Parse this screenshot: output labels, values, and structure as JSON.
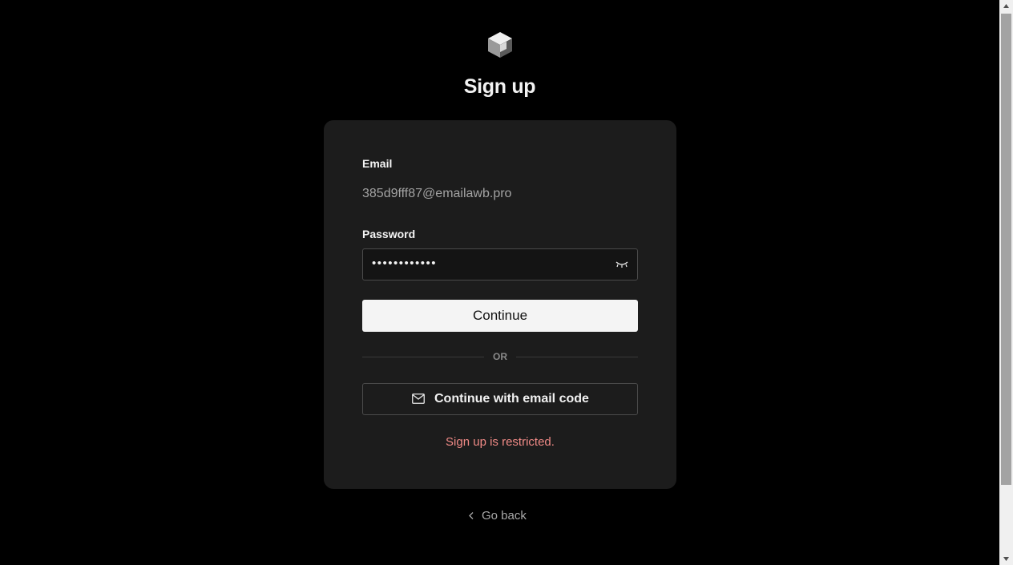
{
  "page": {
    "title": "Sign up"
  },
  "form": {
    "email_label": "Email",
    "email_value": "385d9fff87@emailawb.pro",
    "password_label": "Password",
    "password_masked": "••••••••••••",
    "continue_label": "Continue",
    "divider_text": "OR",
    "email_code_label": "Continue with email code",
    "error_message": "Sign up is restricted."
  },
  "footer": {
    "go_back_label": "Go back"
  },
  "icons": {
    "logo": "cube-logo-icon",
    "password_toggle": "eye-closed-icon",
    "email_code": "mail-icon",
    "go_back": "chevron-left-icon"
  },
  "colors": {
    "background": "#000000",
    "card": "#1c1c1c",
    "primary_button": "#f4f4f4",
    "error": "#f08a86"
  }
}
